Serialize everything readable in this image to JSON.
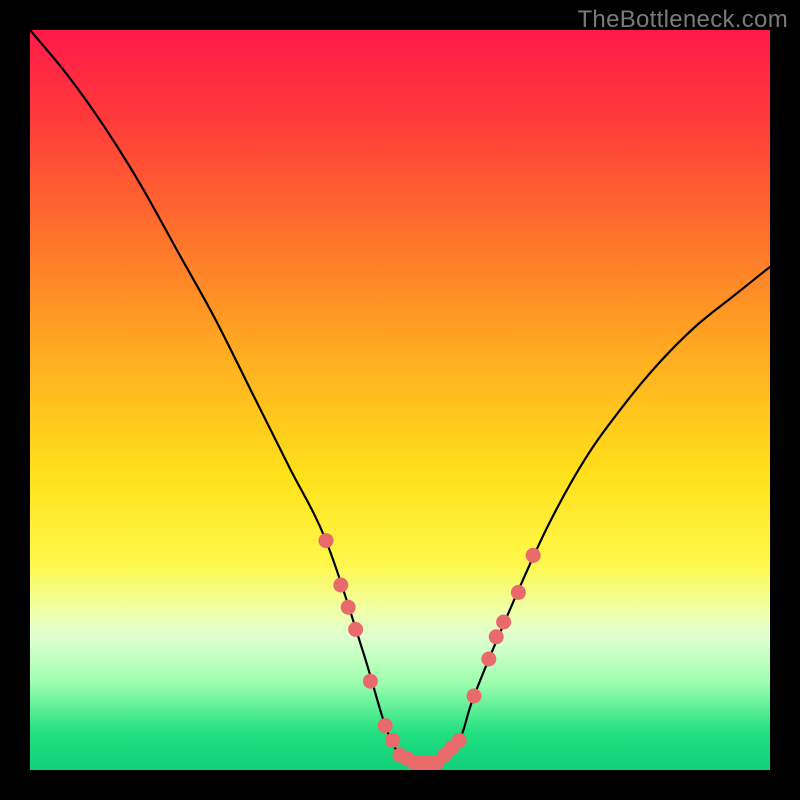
{
  "watermark": "TheBottleneck.com",
  "chart_data": {
    "type": "line",
    "title": "",
    "xlabel": "",
    "ylabel": "",
    "xlim": [
      0,
      100
    ],
    "ylim": [
      0,
      100
    ],
    "series": [
      {
        "name": "bottleneck-curve",
        "x": [
          0,
          5,
          10,
          15,
          20,
          25,
          30,
          35,
          40,
          45,
          48,
          50,
          52,
          55,
          58,
          60,
          65,
          70,
          75,
          80,
          85,
          90,
          95,
          100
        ],
        "y": [
          100,
          94,
          87,
          79,
          70,
          61,
          51,
          41,
          31,
          16,
          6,
          2,
          1,
          1,
          4,
          10,
          22,
          33,
          42,
          49,
          55,
          60,
          64,
          68
        ]
      }
    ],
    "markers": {
      "name": "highlight-dots",
      "color": "#e86a6a",
      "points": [
        {
          "x": 40,
          "y": 31
        },
        {
          "x": 42,
          "y": 25
        },
        {
          "x": 43,
          "y": 22
        },
        {
          "x": 44,
          "y": 19
        },
        {
          "x": 46,
          "y": 12
        },
        {
          "x": 48,
          "y": 6
        },
        {
          "x": 49,
          "y": 4
        },
        {
          "x": 50,
          "y": 2
        },
        {
          "x": 51,
          "y": 1.5
        },
        {
          "x": 52,
          "y": 1
        },
        {
          "x": 53,
          "y": 1
        },
        {
          "x": 54,
          "y": 1
        },
        {
          "x": 55,
          "y": 1
        },
        {
          "x": 56,
          "y": 2
        },
        {
          "x": 57,
          "y": 3
        },
        {
          "x": 58,
          "y": 4
        },
        {
          "x": 60,
          "y": 10
        },
        {
          "x": 62,
          "y": 15
        },
        {
          "x": 63,
          "y": 18
        },
        {
          "x": 64,
          "y": 20
        },
        {
          "x": 66,
          "y": 24
        },
        {
          "x": 68,
          "y": 29
        }
      ]
    }
  }
}
